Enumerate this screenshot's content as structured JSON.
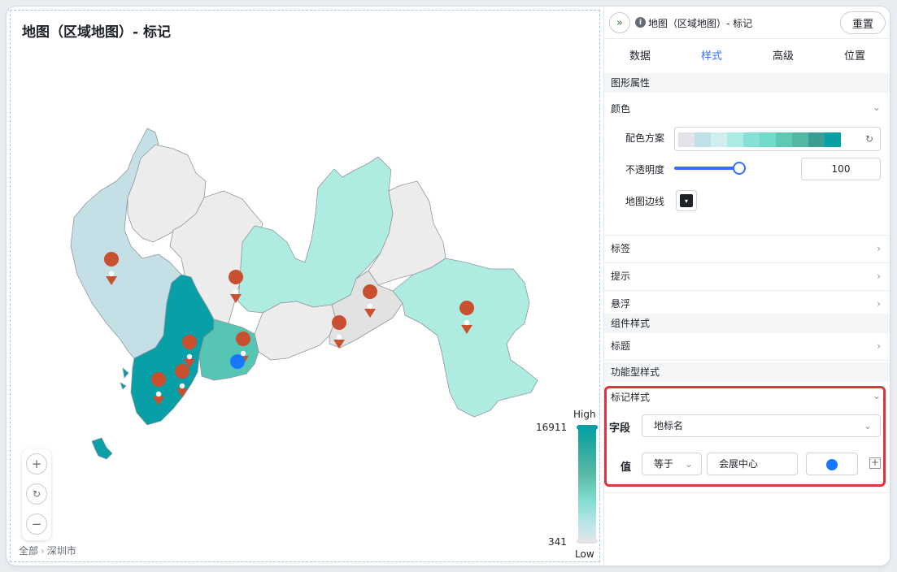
{
  "chart": {
    "title": "地图（区域地图）- 标记",
    "legend": {
      "high": "High",
      "low": "Low",
      "max": "16911",
      "min": "341"
    },
    "breadcrumb": [
      "全部",
      "深圳市"
    ]
  },
  "panel": {
    "header_title": "地图（区域地图）- 标记",
    "reset_label": "重置",
    "tabs": [
      "数据",
      "样式",
      "高级",
      "位置"
    ],
    "active_tab": "样式",
    "sections": {
      "graph_props": "图形属性",
      "color": "颜色",
      "color_scheme_label": "配色方案",
      "opacity_label": "不透明度",
      "opacity_value": "100",
      "map_border_label": "地图边线",
      "label": "标签",
      "tooltip": "提示",
      "hover": "悬浮",
      "component_style": "组件样式",
      "title_row": "标题",
      "functional_style": "功能型样式",
      "marker_style": "标记样式",
      "field_label": "字段",
      "field_value": "地标名",
      "value_label": "值",
      "operator": "等于",
      "compare_value": "会展中心"
    },
    "scheme_colors": [
      "#e2e4e8",
      "#bfe0e6",
      "#cfeeed",
      "#aaece3",
      "#86e0d3",
      "#6fdbc8",
      "#5fc9b4",
      "#55b8a4",
      "#3b9e93",
      "#07a0a6"
    ],
    "marker_color": "#1677ff"
  }
}
